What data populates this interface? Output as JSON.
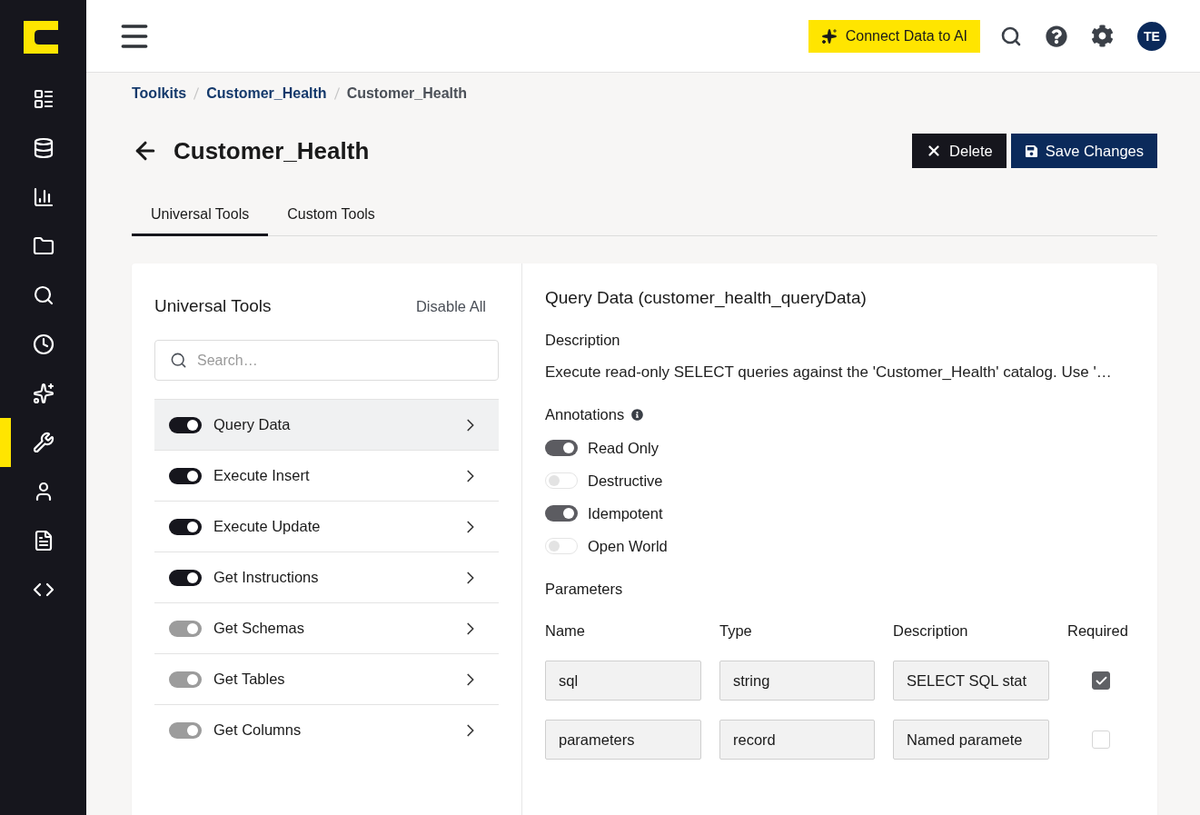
{
  "sidebar": {
    "nav": [
      {
        "selected": false
      },
      {
        "selected": false
      },
      {
        "selected": false
      },
      {
        "selected": false
      },
      {
        "selected": false
      },
      {
        "selected": false
      },
      {
        "selected": false
      },
      {
        "selected": true
      },
      {
        "selected": false
      },
      {
        "selected": false
      },
      {
        "selected": false
      }
    ]
  },
  "top_bar": {
    "connect_button": "Connect Data to AI",
    "avatar": "TE"
  },
  "breadcrumb": [
    {
      "label": "Toolkits",
      "link": true
    },
    {
      "label": "Customer_Health",
      "link": true
    },
    {
      "label": "Customer_Health",
      "link": false
    }
  ],
  "header": {
    "title": "Customer_Health",
    "buttons": [
      {
        "kind": "delete",
        "label": "Delete"
      },
      {
        "kind": "save",
        "label": "Save Changes"
      }
    ]
  },
  "tabs": [
    {
      "label": "Universal Tools",
      "selected": true
    },
    {
      "label": "Custom Tools",
      "selected": false
    }
  ],
  "tools_panel": {
    "title": "Universal Tools",
    "disable_all": "Disable All",
    "search": {
      "placeholder": "Search…"
    },
    "items": [
      {
        "label": "Query Data",
        "on": true,
        "disabled": false,
        "selected": true
      },
      {
        "label": "Execute Insert",
        "on": true,
        "disabled": false,
        "selected": false
      },
      {
        "label": "Execute Update",
        "on": true,
        "disabled": false,
        "selected": false
      },
      {
        "label": "Get Instructions",
        "on": true,
        "disabled": false,
        "selected": false
      },
      {
        "label": "Get Schemas",
        "on": true,
        "disabled": true,
        "selected": false
      },
      {
        "label": "Get Tables",
        "on": true,
        "disabled": true,
        "selected": false
      },
      {
        "label": "Get Columns",
        "on": true,
        "disabled": true,
        "selected": false
      }
    ]
  },
  "detail": {
    "title": "Query Data (customer_health_queryData)",
    "description_label": "Description",
    "description": "Execute read-only SELECT queries against the 'Customer_Health' catalog. Use '…",
    "annotations_label": "Annotations",
    "annotations": [
      {
        "label": "Read Only",
        "on": true
      },
      {
        "label": "Destructive",
        "on": false
      },
      {
        "label": "Idempotent",
        "on": true
      },
      {
        "label": "Open World",
        "on": false
      }
    ],
    "parameters_label": "Parameters",
    "parameters": {
      "columns": [
        "Name",
        "Type",
        "Description",
        "Required"
      ],
      "rows": [
        {
          "name": "sql",
          "type": "string",
          "description": "SELECT SQL stat",
          "required": true
        },
        {
          "name": "parameters",
          "type": "record",
          "description": "Named paramete",
          "required": false
        }
      ]
    }
  }
}
